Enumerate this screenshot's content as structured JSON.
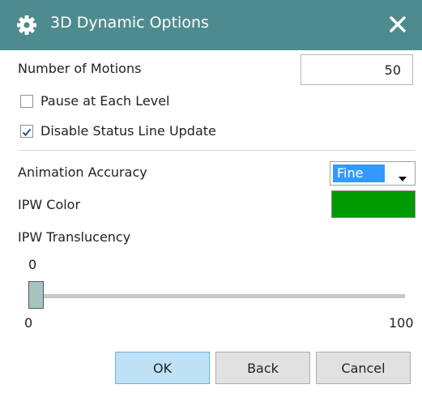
{
  "dialog": {
    "title": "3D Dynamic Options",
    "title_icon": "gear-icon",
    "close_icon": "close-icon"
  },
  "motions": {
    "label": "Number of Motions",
    "value": "50"
  },
  "pause_each_level": {
    "label": "Pause at Each Level",
    "checked": false
  },
  "disable_status_update": {
    "label": "Disable Status Line Update",
    "checked": true
  },
  "animation_accuracy": {
    "label": "Animation Accuracy",
    "selected": "Fine"
  },
  "ipw_color": {
    "label": "IPW Color",
    "color": "#009900"
  },
  "ipw_translucency": {
    "label": "IPW Translucency",
    "value": "0",
    "min": "0",
    "max": "100"
  },
  "buttons": {
    "ok": "OK",
    "back": "Back",
    "cancel": "Cancel"
  },
  "colors": {
    "titlebar": "#4e8b8e",
    "ok_button": "#bfe1f5",
    "selection": "#3399ff"
  }
}
